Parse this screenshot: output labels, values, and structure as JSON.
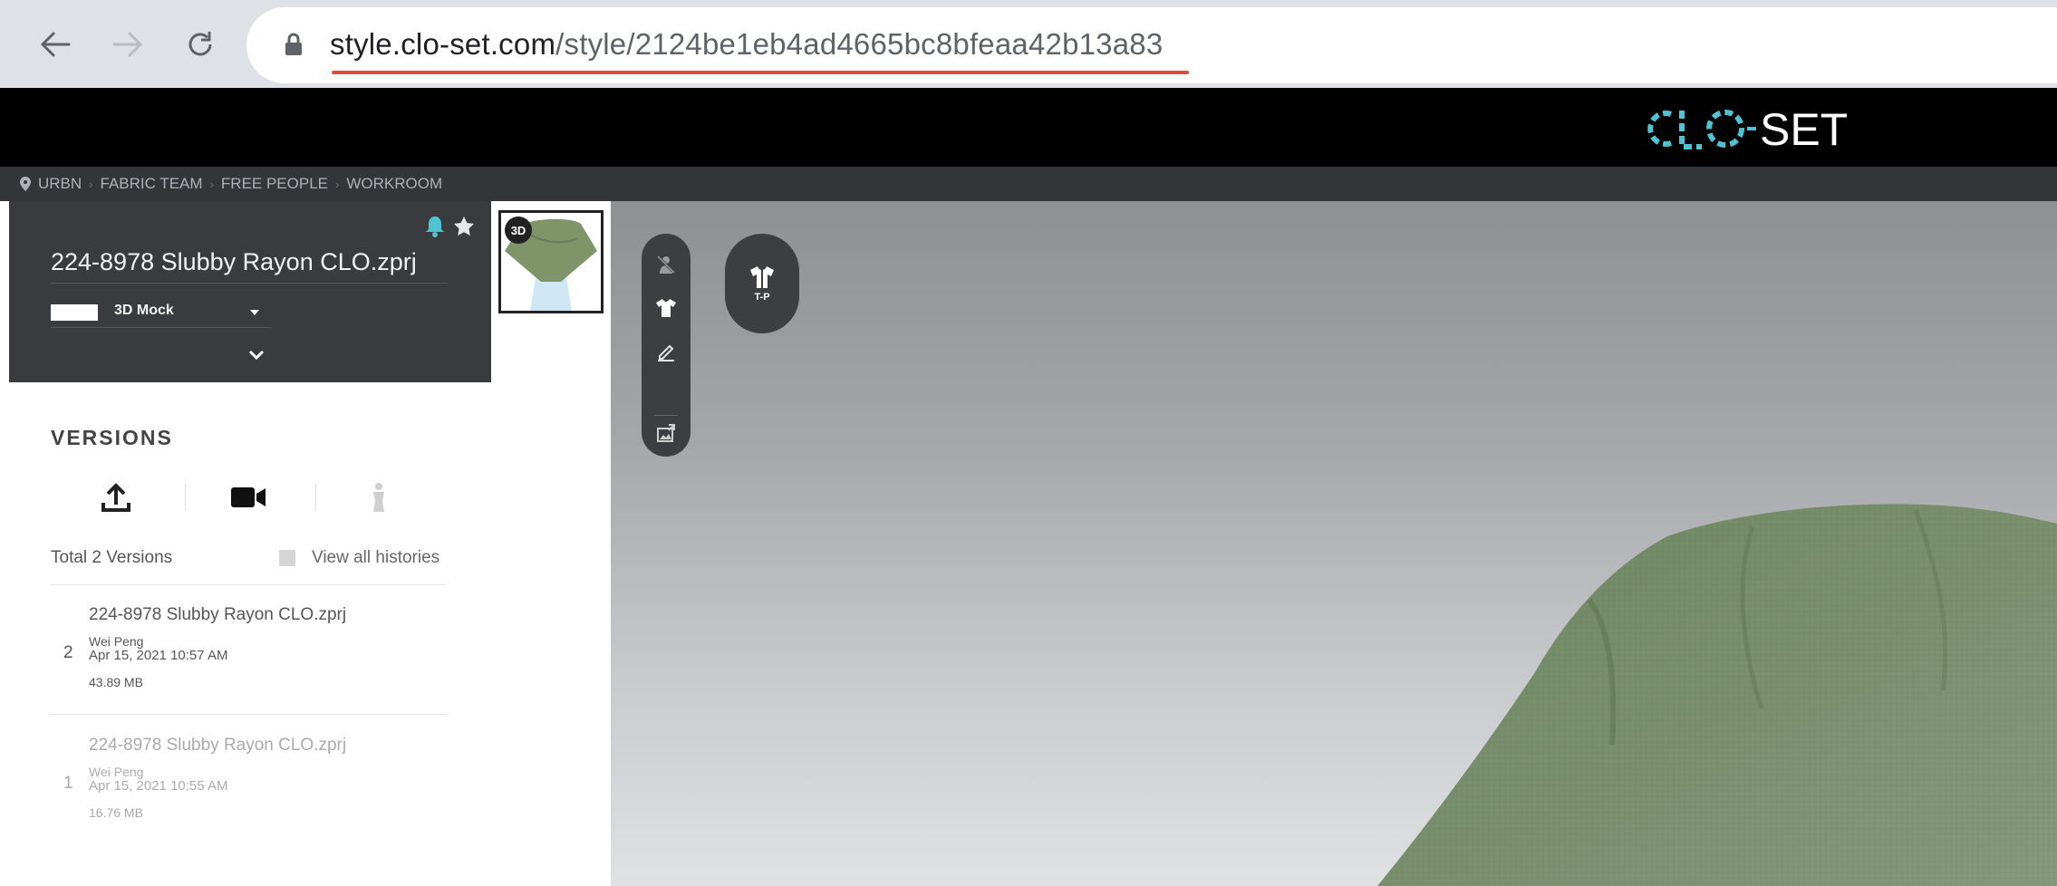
{
  "browser": {
    "url_host": "style.clo-set.com",
    "url_path": "/style/2124be1eb4ad4665bc8bfeaa42b13a83"
  },
  "app": {
    "brand": "CLO-SET",
    "breadcrumb": [
      "URBN",
      "FABRIC TEAM",
      "FREE PEOPLE",
      "WORKROOM"
    ]
  },
  "style": {
    "title": "224-8978 Slubby Rayon CLO.zprj",
    "mode": "3D Mock"
  },
  "versions": {
    "heading": "VERSIONS",
    "total": "Total 2 Versions",
    "view_all": "View all histories",
    "items": [
      {
        "number": "2",
        "name": "224-8978 Slubby Rayon CLO.zprj",
        "author": "Wei Peng",
        "date": "Apr 15, 2021 10:57 AM",
        "size": "43.89 MB"
      },
      {
        "number": "1",
        "name": "224-8978 Slubby Rayon CLO.zprj",
        "author": "Wei Peng",
        "date": "Apr 15, 2021 10:55 AM",
        "size": "16.76 MB"
      }
    ]
  },
  "viewer": {
    "thumb_badge": "3D",
    "tp_label": "T-P"
  },
  "colors": {
    "accent_teal": "#4ec3d3",
    "garment_green": "#6f8761",
    "underline_red": "#e8453c"
  }
}
